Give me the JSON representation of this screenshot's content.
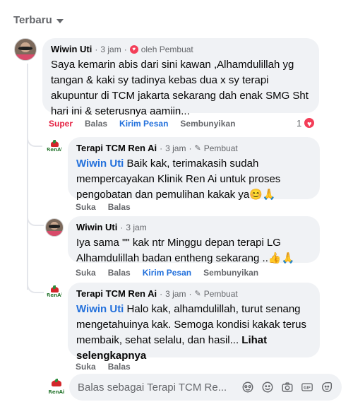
{
  "sort": {
    "label": "Terbaru"
  },
  "comments": [
    {
      "author": "Wiwin Uti",
      "time": "3 jam",
      "badge": "oleh Pembuat",
      "text": "Saya kemarin abis dari sini kawan ,Alhamdulillah yg tangan & kaki sy tadinya kebas dua x sy terapi akupuntur di TCM jakarta sekarang dah enak SMG Sht hari ini & seterusnya aamiin...",
      "actions": {
        "react": "Super",
        "reply": "Balas",
        "message": "Kirim Pesan",
        "hide": "Sembunyikan"
      },
      "reaction_count": "1"
    },
    {
      "author": "Terapi TCM Ren Ai",
      "time": "3 jam",
      "badge": "Pembuat",
      "mention": "Wiwin Uti",
      "text": "Baik kak, terimakasih sudah mempercayakan Klinik Ren Ai untuk proses pengobatan dan pemulihan kakak ya😊🙏",
      "actions": {
        "react": "Suka",
        "reply": "Balas"
      }
    },
    {
      "author": "Wiwin Uti",
      "time": "3 jam",
      "text": "Iya sama \"\" kak ntr Minggu depan terapi LG Alhamdulillah badan entheng sekarang ..👍🙏",
      "actions": {
        "react": "Suka",
        "reply": "Balas",
        "message": "Kirim Pesan",
        "hide": "Sembunyikan"
      }
    },
    {
      "author": "Terapi TCM Ren Ai",
      "time": "3 jam",
      "badge": "Pembuat",
      "mention": "Wiwin Uti",
      "text": "Halo kak, alhamdulillah, turut senang mengetahuinya kak. Semoga kondisi kakak terus membaik, sehat selalu, dan hasil...",
      "see_more": "Lihat selengkapnya",
      "actions": {
        "react": "Suka",
        "reply": "Balas"
      }
    }
  ],
  "reply_box": {
    "placeholder": "Balas sebagai Terapi TCM Re..."
  },
  "clinic_logo_text": "RenAi",
  "colors": {
    "accent": "#216fdb",
    "heart": "#f33e58",
    "super": "#e41e3f"
  }
}
